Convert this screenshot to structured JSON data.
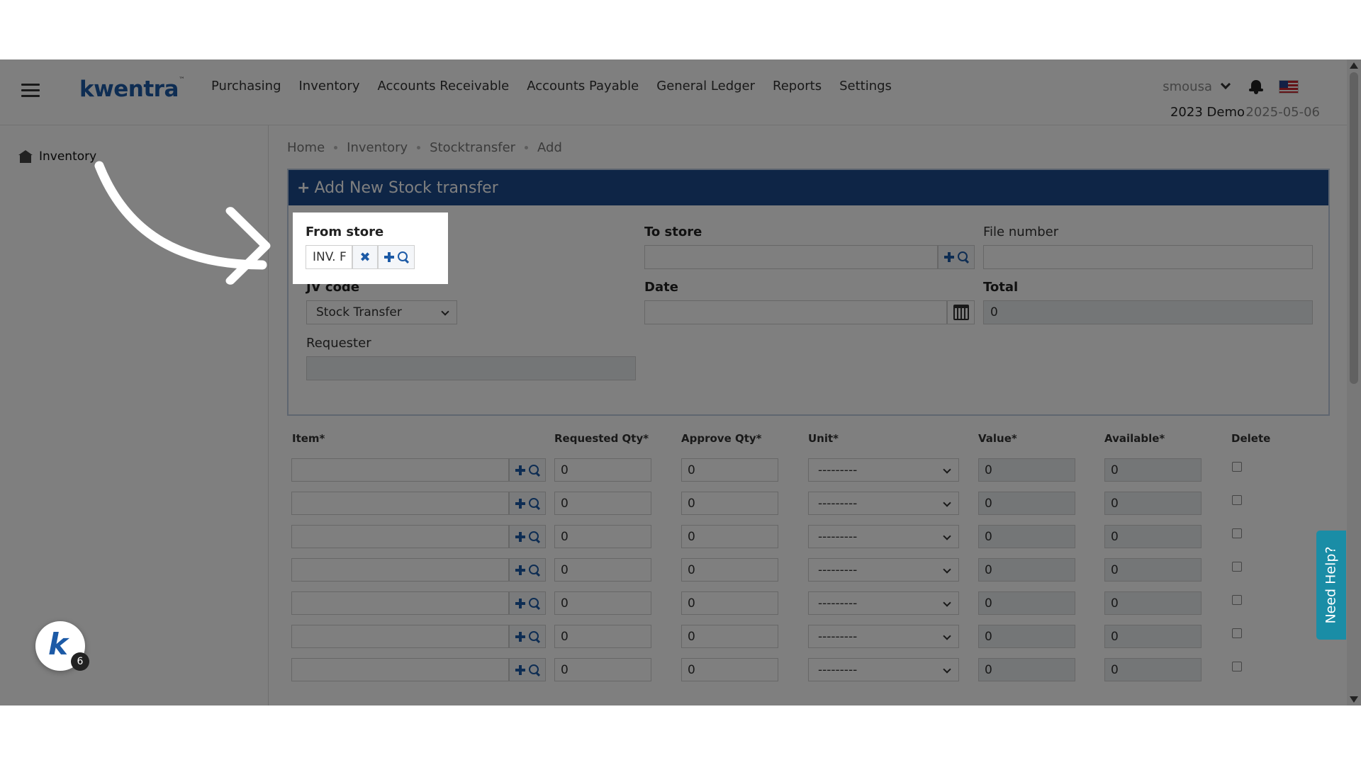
{
  "app": {
    "logo": "kwentra",
    "logo_tm": "™"
  },
  "nav": [
    "Purchasing",
    "Inventory",
    "Accounts Receivable",
    "Accounts Payable",
    "General Ledger",
    "Reports",
    "Settings"
  ],
  "user": {
    "name": "smousa",
    "company": "2023 Demo",
    "date": "2025-05-06"
  },
  "sidebar": {
    "item": "Inventory"
  },
  "breadcrumb": [
    "Home",
    "Inventory",
    "Stocktransfer",
    "Add"
  ],
  "panel": {
    "title": "Add New Stock transfer",
    "plus": "+",
    "from_store": {
      "label": "From store",
      "value": "INV. F"
    },
    "to_store": {
      "label": "To store",
      "value": ""
    },
    "file_number": {
      "label": "File number",
      "value": ""
    },
    "jv_code": {
      "label": "JV code",
      "value": "Stock Transfer"
    },
    "date": {
      "label": "Date",
      "value": ""
    },
    "total": {
      "label": "Total",
      "value": "0"
    },
    "requester": {
      "label": "Requester",
      "value": ""
    }
  },
  "table": {
    "headers": [
      "Item*",
      "Requested Qty*",
      "Approve Qty*",
      "Unit*",
      "Value*",
      "Available*",
      "Delete"
    ],
    "rows": [
      {
        "item": "",
        "req": "0",
        "appr": "0",
        "unit": "---------",
        "value": "0",
        "avail": "0"
      },
      {
        "item": "",
        "req": "0",
        "appr": "0",
        "unit": "---------",
        "value": "0",
        "avail": "0"
      },
      {
        "item": "",
        "req": "0",
        "appr": "0",
        "unit": "---------",
        "value": "0",
        "avail": "0"
      },
      {
        "item": "",
        "req": "0",
        "appr": "0",
        "unit": "---------",
        "value": "0",
        "avail": "0"
      },
      {
        "item": "",
        "req": "0",
        "appr": "0",
        "unit": "---------",
        "value": "0",
        "avail": "0"
      },
      {
        "item": "",
        "req": "0",
        "appr": "0",
        "unit": "---------",
        "value": "0",
        "avail": "0"
      },
      {
        "item": "",
        "req": "0",
        "appr": "0",
        "unit": "---------",
        "value": "0",
        "avail": "0"
      }
    ]
  },
  "help": {
    "label": "Need Help?"
  },
  "bubble": {
    "letter": "k",
    "count": "6"
  },
  "colors": {
    "brand": "#1c5aa6",
    "panel_header": "#1c4a8c",
    "help": "#1a8da6"
  }
}
